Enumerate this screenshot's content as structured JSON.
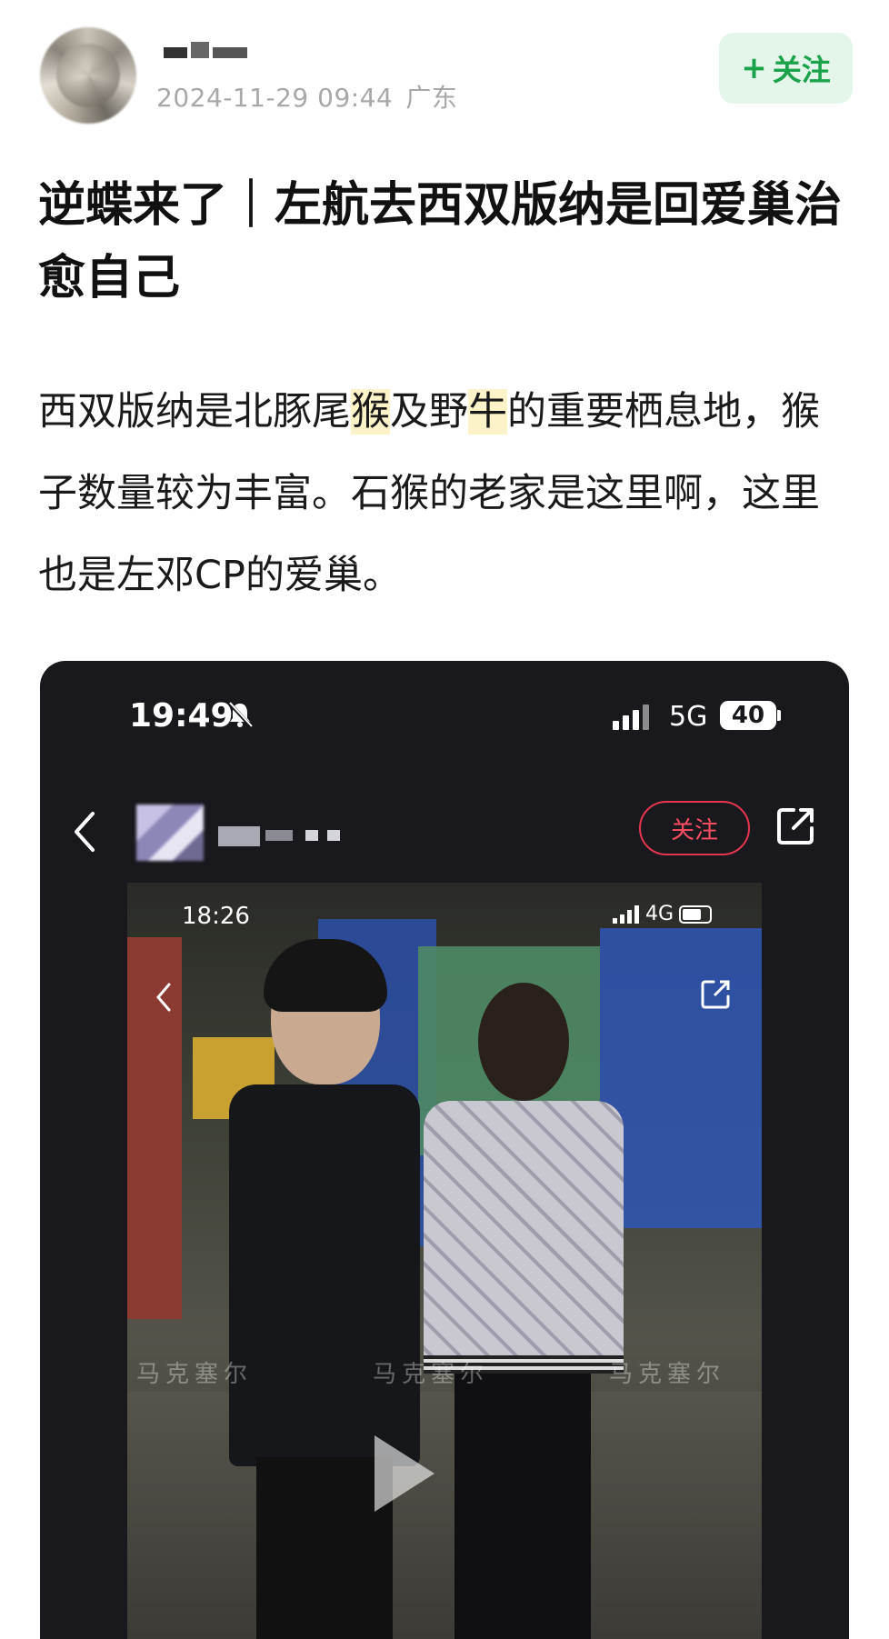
{
  "header": {
    "timestamp": "2024-11-29 09:44",
    "location": "广东",
    "follow_label": "关注"
  },
  "article": {
    "title": "逆蝶来了｜左航去西双版纳是回爱巢治愈自己",
    "body": {
      "p1_a": "西双版纳是北豚尾",
      "p1_hl1": "猴",
      "p1_b": "及野",
      "p1_hl2": "牛",
      "p1_c": "的重要栖息地，猴子数量较为丰富。石猴的老家是这里啊，这里也是左邓CP的爱巢。"
    }
  },
  "embedded": {
    "status": {
      "time": "19:49",
      "network": "5G",
      "battery": "40"
    },
    "follow_label": "关注",
    "video": {
      "time": "18:26",
      "network": "4G",
      "watermark": "马克塞尔"
    }
  },
  "icons": [
    "mute-bell-icon",
    "signal-icon",
    "battery-icon",
    "back-icon",
    "share-icon",
    "play-icon"
  ],
  "colors": {
    "follow_green": "#1aa34a",
    "follow_bg": "#e4f6e9",
    "highlight": "#fdf3c8",
    "embedded_bg": "#18181d",
    "embedded_follow": "#ff4e63"
  }
}
